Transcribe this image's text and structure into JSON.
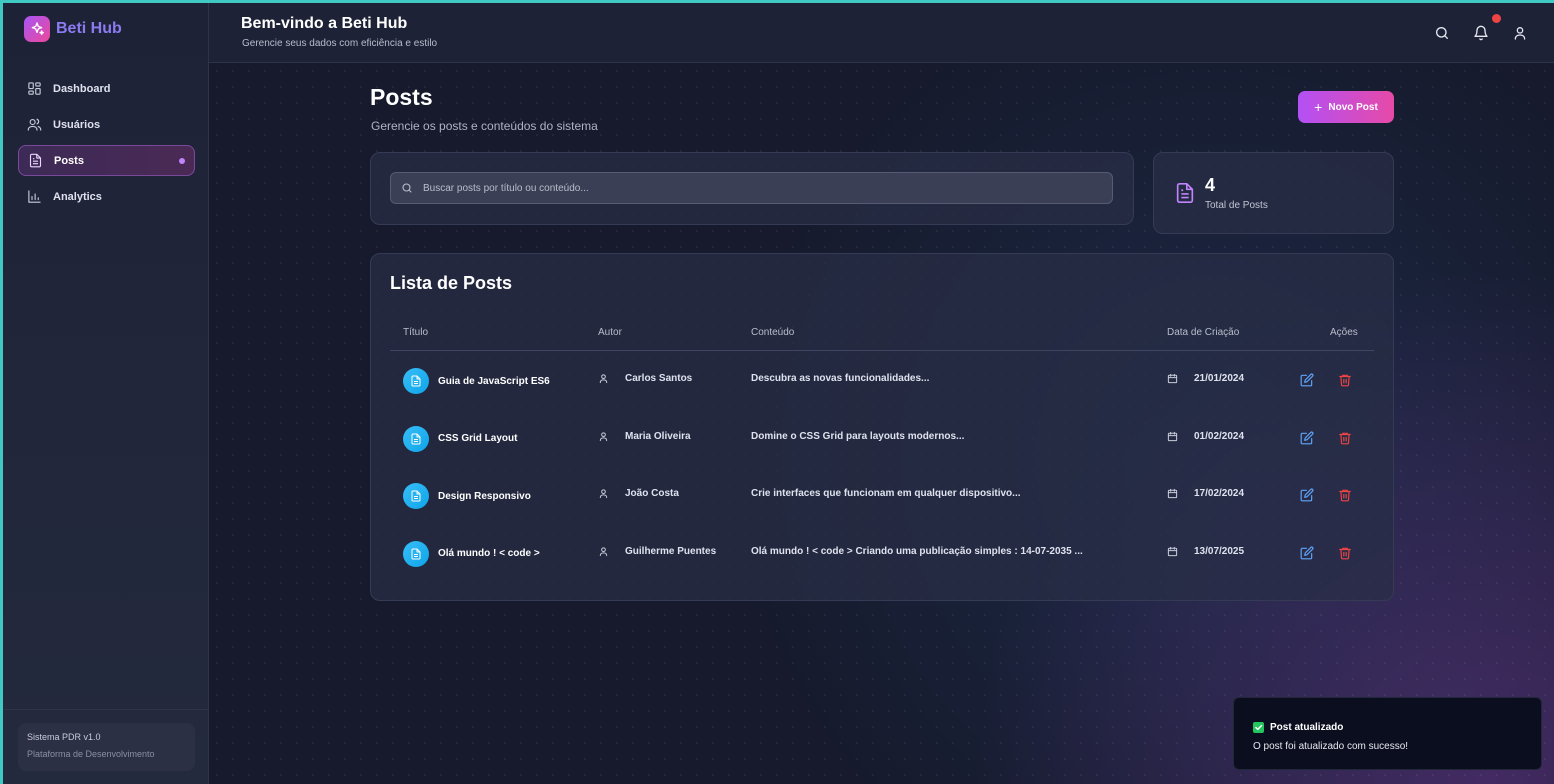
{
  "brand": {
    "name": "Beti Hub"
  },
  "sidebar": {
    "items": [
      {
        "label": "Dashboard",
        "icon": "dashboard-icon",
        "active": false
      },
      {
        "label": "Usuários",
        "icon": "users-icon",
        "active": false
      },
      {
        "label": "Posts",
        "icon": "document-icon",
        "active": true
      },
      {
        "label": "Analytics",
        "icon": "bar-chart-icon",
        "active": false
      }
    ],
    "system": {
      "title": "Sistema PDR v1.0",
      "subtitle": "Plataforma de Desenvolvimento"
    }
  },
  "header": {
    "title": "Bem-vindo a Beti Hub",
    "subtitle": "Gerencie seus dados com eficiência e estilo",
    "icons": [
      "search-icon",
      "bell-icon",
      "user-icon"
    ]
  },
  "page": {
    "title": "Posts",
    "subtitle": "Gerencie os posts e conteúdos do sistema",
    "new_button": "Novo Post"
  },
  "search": {
    "placeholder": "Buscar posts por título ou conteúdo..."
  },
  "stats": {
    "total": "4",
    "label": "Total de Posts"
  },
  "list": {
    "title": "Lista de Posts",
    "columns": [
      "Título",
      "Autor",
      "Conteúdo",
      "Data de Criação",
      "Ações"
    ],
    "rows": [
      {
        "title": "Guia de JavaScript ES6",
        "author": "Carlos Santos",
        "content": "Descubra as novas funcionalidades...",
        "date": "21/01/2024"
      },
      {
        "title": "CSS Grid Layout",
        "author": "Maria Oliveira",
        "content": "Domine o CSS Grid para layouts modernos...",
        "date": "01/02/2024"
      },
      {
        "title": "Design Responsivo",
        "author": "João Costa",
        "content": "Crie interfaces que funcionam em qualquer dispositivo...",
        "date": "17/02/2024"
      },
      {
        "title": "Olá mundo ! < code >",
        "author": "Guilherme Puentes",
        "content": "Olá mundo ! < code > Criando uma publicação simples : 14-07-2035 ...",
        "date": "13/07/2025"
      }
    ]
  },
  "toast": {
    "title": "Post atualizado",
    "message": "O post foi atualizado com sucesso!"
  },
  "colors": {
    "accent": "#a855f7",
    "accent2": "#ec4899",
    "edit": "#60a5fa",
    "delete": "#ef4444",
    "badge": "#0ea5e9"
  }
}
